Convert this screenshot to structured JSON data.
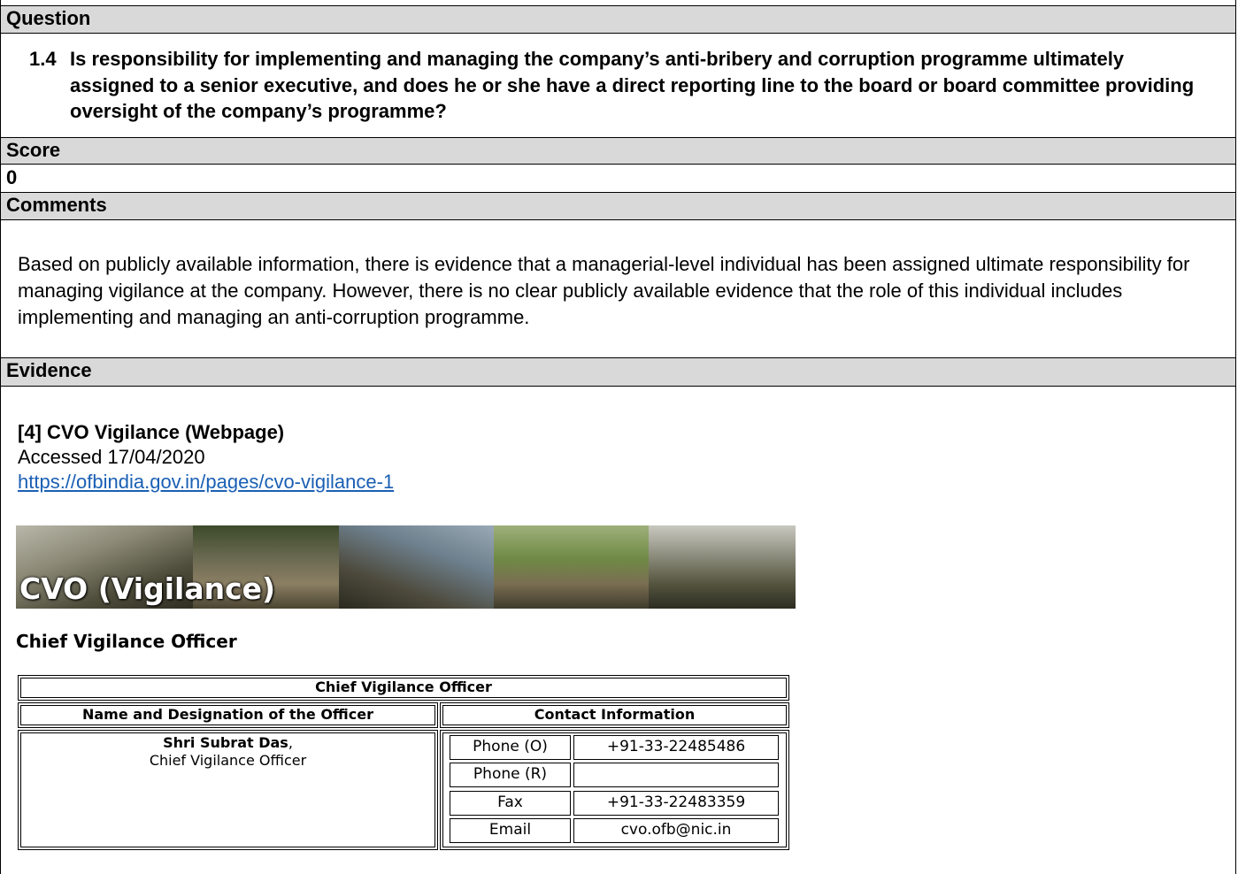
{
  "sections": {
    "question_label": "Question",
    "score_label": "Score",
    "comments_label": "Comments",
    "evidence_label": "Evidence"
  },
  "question": {
    "number": "1.4",
    "text": "Is responsibility for implementing and managing the company’s anti-bribery and corruption programme ultimately assigned to a senior executive, and does he or she have a direct reporting line to the board or board committee providing oversight of the company’s programme?"
  },
  "score": {
    "value": "0"
  },
  "comments": {
    "text": "Based on publicly available information, there is evidence that a managerial-level individual has been assigned ultimate responsibility for managing vigilance at the company. However, there is no clear publicly available evidence that the role of this individual includes implementing and managing an anti-corruption programme."
  },
  "evidence": {
    "title": "[4] CVO Vigilance (Webpage)",
    "accessed": "Accessed 17/04/2020",
    "url": "https://ofbindia.gov.in/pages/cvo-vigilance-1"
  },
  "webpage": {
    "banner_title": "CVO (Vigilance)",
    "heading": "Chief Vigilance Officer",
    "table": {
      "title": "Chief Vigilance Officer",
      "col_name": "Name and Designation of the Officer",
      "col_contact": "Contact Information",
      "officer_name": "Shri Subrat Das",
      "officer_name_suffix": ",",
      "officer_designation": "Chief Vigilance Officer",
      "contacts": [
        {
          "label": "Phone (O)",
          "value": "+91-33-22485486"
        },
        {
          "label": "Phone (R)",
          "value": ""
        },
        {
          "label": "Fax",
          "value": "+91-33-22483359"
        },
        {
          "label": "Email",
          "value": "cvo.ofb@nic.in"
        }
      ]
    }
  },
  "colors": {
    "header_bg": "#d9d9d9",
    "link": "#1a5fb4"
  }
}
